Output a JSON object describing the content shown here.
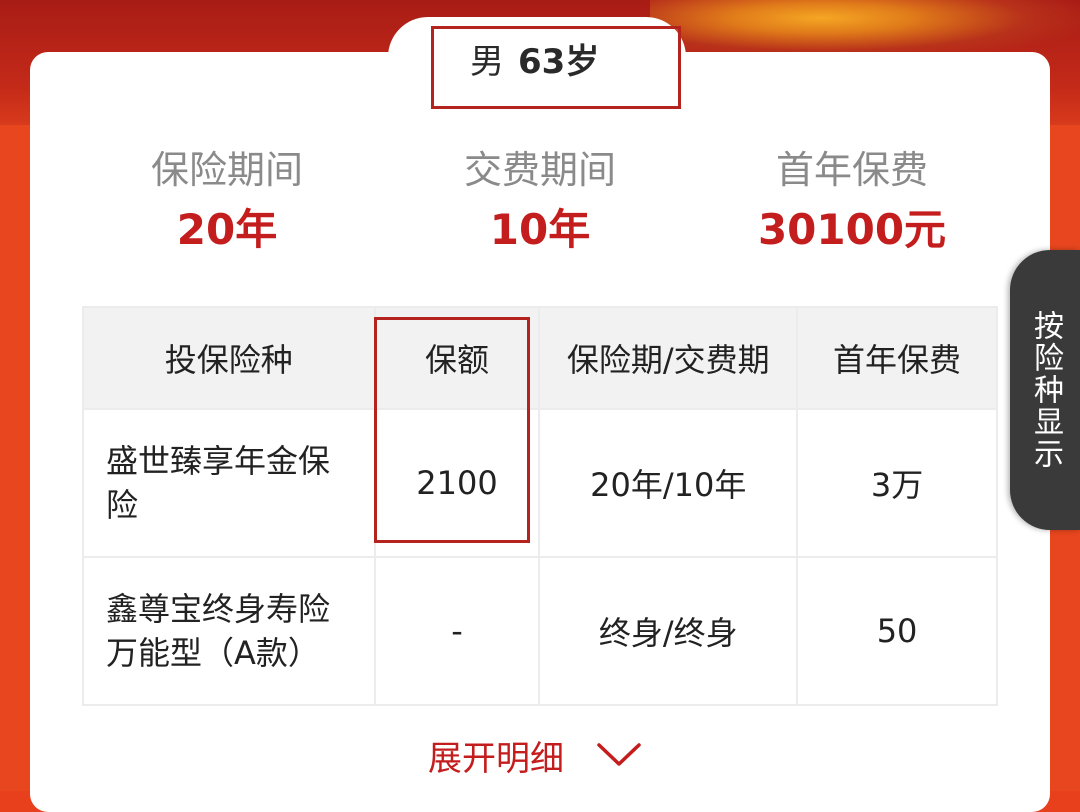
{
  "profile": {
    "gender": "男",
    "age": "63岁"
  },
  "summary": [
    {
      "label": "保险期间",
      "value": "20年"
    },
    {
      "label": "交费期间",
      "value": "10年"
    },
    {
      "label": "首年保费",
      "value": "30100元"
    }
  ],
  "table": {
    "headers": [
      "投保险种",
      "保额",
      "保险期/交费期",
      "首年保费"
    ],
    "rows": [
      {
        "product_line1": "盛世臻享年金保",
        "product_line2": "险",
        "amount": "2100",
        "period": "20年/10年",
        "premium": "3万"
      },
      {
        "product_line1": "鑫尊宝终身寿险",
        "product_line2": "万能型（A款）",
        "amount": "-",
        "period": "终身/终身",
        "premium": "50"
      }
    ]
  },
  "side_tab": {
    "label": "按险种显示"
  },
  "expand": {
    "label": "展开明细",
    "icon": "chevron-down-icon"
  },
  "colors": {
    "accent": "#c41d1d",
    "highlight_border": "#b5231e",
    "background": "#e8461e"
  }
}
